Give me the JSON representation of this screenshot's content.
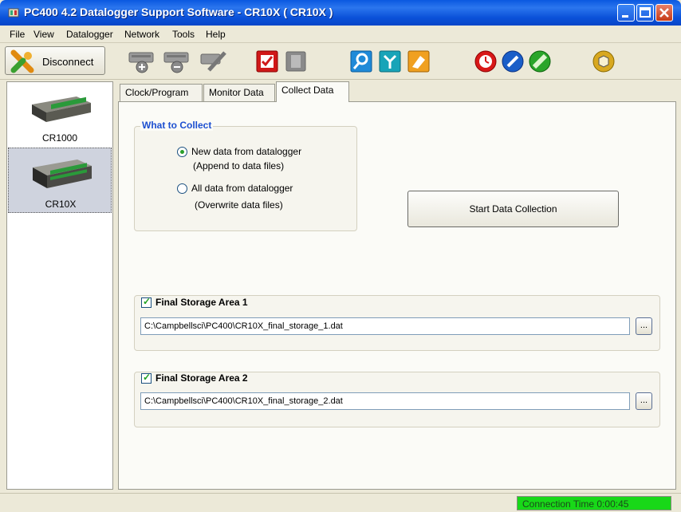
{
  "window": {
    "title": "PC400 4.2 Datalogger Support Software - CR10X ( CR10X )"
  },
  "menu": {
    "items": [
      "File",
      "View",
      "Datalogger",
      "Network",
      "Tools",
      "Help"
    ]
  },
  "toolbar": {
    "disconnect_label": "Disconnect",
    "icons": [
      "add-datalogger-icon",
      "remove-datalogger-icon",
      "edit-datalogger-icon",
      "checklist-icon",
      "clipboard-icon",
      "search-icon",
      "network-icon",
      "eraser-icon",
      "stopwatch-icon",
      "pen-icon",
      "ruler-icon",
      "cube-icon"
    ]
  },
  "dataloggers": [
    {
      "name": "CR1000",
      "selected": false
    },
    {
      "name": "CR10X",
      "selected": true
    }
  ],
  "tabs": [
    {
      "label": "Clock/Program",
      "active": false
    },
    {
      "label": "Monitor Data",
      "active": false
    },
    {
      "label": "Collect Data",
      "active": true
    }
  ],
  "collect": {
    "group_title": "What to Collect",
    "option_new_line1": "New data from datalogger",
    "option_new_line2": "(Append to data files)",
    "option_all_line1": "All data from datalogger",
    "option_all_line2": "(Overwrite data files)",
    "selected_option": "new",
    "start_button": "Start Data Collection"
  },
  "storage_areas": [
    {
      "label": "Final Storage Area 1",
      "checked": true,
      "path": "C:\\Campbellsci\\PC400\\CR10X_final_storage_1.dat",
      "browse": "..."
    },
    {
      "label": "Final Storage Area 2",
      "checked": true,
      "path": "C:\\Campbellsci\\PC400\\CR10X_final_storage_2.dat",
      "browse": "..."
    }
  ],
  "status": {
    "connection_time": "Connection Time 0:00:45"
  },
  "colors": {
    "title_blue": "#0a58e0",
    "group_title_blue": "#1c4fd0",
    "status_green": "#18d818"
  }
}
